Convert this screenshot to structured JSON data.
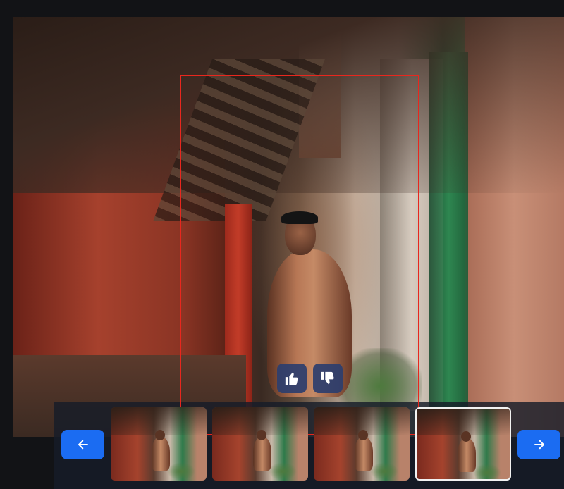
{
  "viewer": {
    "main_image_icon": "photo-alley-portrait",
    "selection_color": "#e8271e"
  },
  "feedback": {
    "like_icon": "thumbs-up-icon",
    "dislike_icon": "thumbs-down-icon",
    "button_color": "#2c3e6e"
  },
  "navigation": {
    "prev_icon": "arrow-left-icon",
    "next_icon": "arrow-right-icon",
    "accent": "#1b6cf2"
  },
  "thumbnails": {
    "count": 4,
    "selected_index": 3
  }
}
